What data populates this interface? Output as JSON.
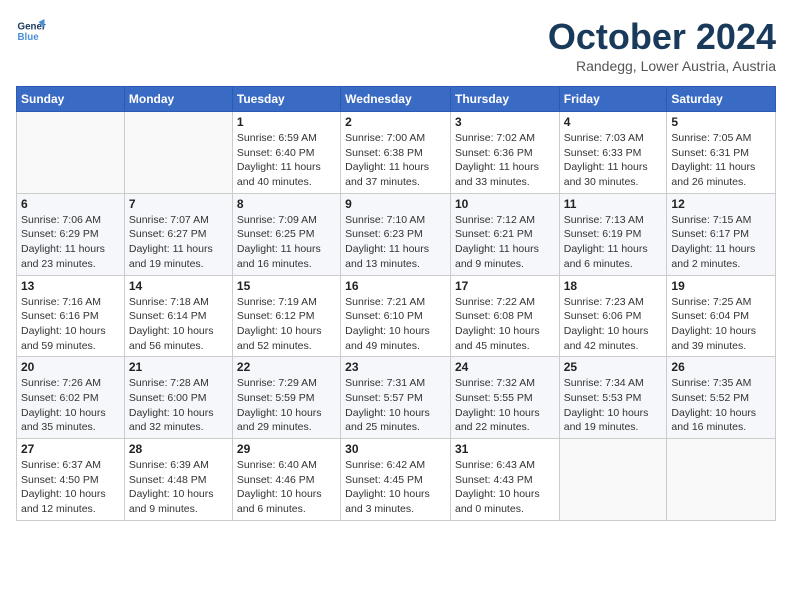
{
  "header": {
    "logo_line1": "General",
    "logo_line2": "Blue",
    "month": "October 2024",
    "location": "Randegg, Lower Austria, Austria"
  },
  "weekdays": [
    "Sunday",
    "Monday",
    "Tuesday",
    "Wednesday",
    "Thursday",
    "Friday",
    "Saturday"
  ],
  "weeks": [
    [
      {
        "day": "",
        "detail": ""
      },
      {
        "day": "",
        "detail": ""
      },
      {
        "day": "1",
        "detail": "Sunrise: 6:59 AM\nSunset: 6:40 PM\nDaylight: 11 hours and 40 minutes."
      },
      {
        "day": "2",
        "detail": "Sunrise: 7:00 AM\nSunset: 6:38 PM\nDaylight: 11 hours and 37 minutes."
      },
      {
        "day": "3",
        "detail": "Sunrise: 7:02 AM\nSunset: 6:36 PM\nDaylight: 11 hours and 33 minutes."
      },
      {
        "day": "4",
        "detail": "Sunrise: 7:03 AM\nSunset: 6:33 PM\nDaylight: 11 hours and 30 minutes."
      },
      {
        "day": "5",
        "detail": "Sunrise: 7:05 AM\nSunset: 6:31 PM\nDaylight: 11 hours and 26 minutes."
      }
    ],
    [
      {
        "day": "6",
        "detail": "Sunrise: 7:06 AM\nSunset: 6:29 PM\nDaylight: 11 hours and 23 minutes."
      },
      {
        "day": "7",
        "detail": "Sunrise: 7:07 AM\nSunset: 6:27 PM\nDaylight: 11 hours and 19 minutes."
      },
      {
        "day": "8",
        "detail": "Sunrise: 7:09 AM\nSunset: 6:25 PM\nDaylight: 11 hours and 16 minutes."
      },
      {
        "day": "9",
        "detail": "Sunrise: 7:10 AM\nSunset: 6:23 PM\nDaylight: 11 hours and 13 minutes."
      },
      {
        "day": "10",
        "detail": "Sunrise: 7:12 AM\nSunset: 6:21 PM\nDaylight: 11 hours and 9 minutes."
      },
      {
        "day": "11",
        "detail": "Sunrise: 7:13 AM\nSunset: 6:19 PM\nDaylight: 11 hours and 6 minutes."
      },
      {
        "day": "12",
        "detail": "Sunrise: 7:15 AM\nSunset: 6:17 PM\nDaylight: 11 hours and 2 minutes."
      }
    ],
    [
      {
        "day": "13",
        "detail": "Sunrise: 7:16 AM\nSunset: 6:16 PM\nDaylight: 10 hours and 59 minutes."
      },
      {
        "day": "14",
        "detail": "Sunrise: 7:18 AM\nSunset: 6:14 PM\nDaylight: 10 hours and 56 minutes."
      },
      {
        "day": "15",
        "detail": "Sunrise: 7:19 AM\nSunset: 6:12 PM\nDaylight: 10 hours and 52 minutes."
      },
      {
        "day": "16",
        "detail": "Sunrise: 7:21 AM\nSunset: 6:10 PM\nDaylight: 10 hours and 49 minutes."
      },
      {
        "day": "17",
        "detail": "Sunrise: 7:22 AM\nSunset: 6:08 PM\nDaylight: 10 hours and 45 minutes."
      },
      {
        "day": "18",
        "detail": "Sunrise: 7:23 AM\nSunset: 6:06 PM\nDaylight: 10 hours and 42 minutes."
      },
      {
        "day": "19",
        "detail": "Sunrise: 7:25 AM\nSunset: 6:04 PM\nDaylight: 10 hours and 39 minutes."
      }
    ],
    [
      {
        "day": "20",
        "detail": "Sunrise: 7:26 AM\nSunset: 6:02 PM\nDaylight: 10 hours and 35 minutes."
      },
      {
        "day": "21",
        "detail": "Sunrise: 7:28 AM\nSunset: 6:00 PM\nDaylight: 10 hours and 32 minutes."
      },
      {
        "day": "22",
        "detail": "Sunrise: 7:29 AM\nSunset: 5:59 PM\nDaylight: 10 hours and 29 minutes."
      },
      {
        "day": "23",
        "detail": "Sunrise: 7:31 AM\nSunset: 5:57 PM\nDaylight: 10 hours and 25 minutes."
      },
      {
        "day": "24",
        "detail": "Sunrise: 7:32 AM\nSunset: 5:55 PM\nDaylight: 10 hours and 22 minutes."
      },
      {
        "day": "25",
        "detail": "Sunrise: 7:34 AM\nSunset: 5:53 PM\nDaylight: 10 hours and 19 minutes."
      },
      {
        "day": "26",
        "detail": "Sunrise: 7:35 AM\nSunset: 5:52 PM\nDaylight: 10 hours and 16 minutes."
      }
    ],
    [
      {
        "day": "27",
        "detail": "Sunrise: 6:37 AM\nSunset: 4:50 PM\nDaylight: 10 hours and 12 minutes."
      },
      {
        "day": "28",
        "detail": "Sunrise: 6:39 AM\nSunset: 4:48 PM\nDaylight: 10 hours and 9 minutes."
      },
      {
        "day": "29",
        "detail": "Sunrise: 6:40 AM\nSunset: 4:46 PM\nDaylight: 10 hours and 6 minutes."
      },
      {
        "day": "30",
        "detail": "Sunrise: 6:42 AM\nSunset: 4:45 PM\nDaylight: 10 hours and 3 minutes."
      },
      {
        "day": "31",
        "detail": "Sunrise: 6:43 AM\nSunset: 4:43 PM\nDaylight: 10 hours and 0 minutes."
      },
      {
        "day": "",
        "detail": ""
      },
      {
        "day": "",
        "detail": ""
      }
    ]
  ]
}
